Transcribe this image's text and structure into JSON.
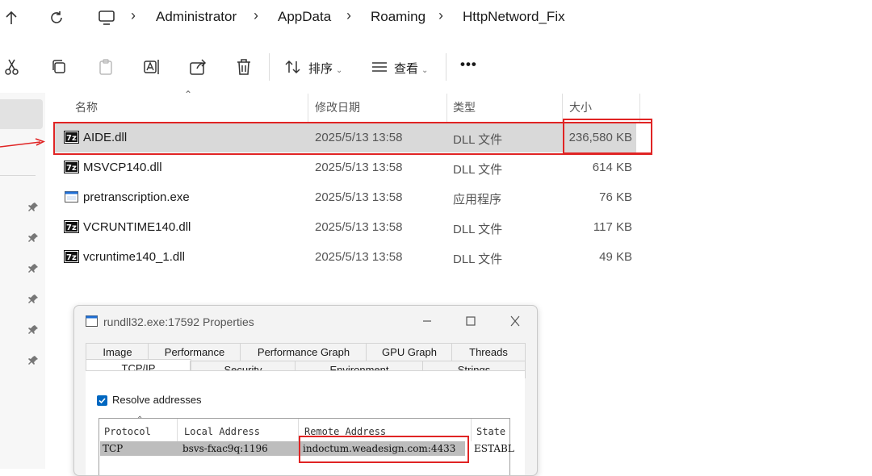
{
  "address_bar": {
    "crumbs": [
      "Administrator",
      "AppData",
      "Roaming",
      "HttpNetword_Fix"
    ]
  },
  "toolbar": {
    "sort_label": "排序",
    "view_label": "查看",
    "more_label": "•••"
  },
  "file_list": {
    "columns": {
      "name": "名称",
      "modified": "修改日期",
      "type": "类型",
      "size": "大小"
    },
    "rows": [
      {
        "name": "AIDE.dll",
        "modified": "2025/5/13 13:58",
        "type": "DLL 文件",
        "size": "236,580 KB",
        "icon": "7z-dll-icon",
        "selected": true
      },
      {
        "name": "MSVCP140.dll",
        "modified": "2025/5/13 13:58",
        "type": "DLL 文件",
        "size": "614 KB",
        "icon": "7z-dll-icon"
      },
      {
        "name": "pretranscription.exe",
        "modified": "2025/5/13 13:58",
        "type": "应用程序",
        "size": "76 KB",
        "icon": "exe-icon"
      },
      {
        "name": "VCRUNTIME140.dll",
        "modified": "2025/5/13 13:58",
        "type": "DLL 文件",
        "size": "117 KB",
        "icon": "7z-dll-icon"
      },
      {
        "name": "vcruntime140_1.dll",
        "modified": "2025/5/13 13:58",
        "type": "DLL 文件",
        "size": "49 KB",
        "icon": "7z-dll-icon"
      }
    ]
  },
  "properties_window": {
    "title": "rundll32.exe:17592 Properties",
    "tabs_row1": [
      "Image",
      "Performance",
      "Performance Graph",
      "GPU Graph",
      "Threads"
    ],
    "tabs_row2": [
      "TCP/IP",
      "Security",
      "Environment",
      "Strings"
    ],
    "active_tab": "TCP/IP",
    "resolve_addresses_label": "Resolve addresses",
    "resolve_addresses_checked": true,
    "grid_columns": [
      "Protocol",
      "Local Address",
      "Remote Address",
      "State"
    ],
    "connections": [
      {
        "protocol": "TCP",
        "local": "bsvs-fxac9q:1196",
        "remote": "indoctum.weadesign.com:4433",
        "state": "ESTABL"
      }
    ]
  },
  "colors": {
    "highlight": "#e02424",
    "accent": "#0067c0",
    "selected_row": "#d9d9d9"
  }
}
